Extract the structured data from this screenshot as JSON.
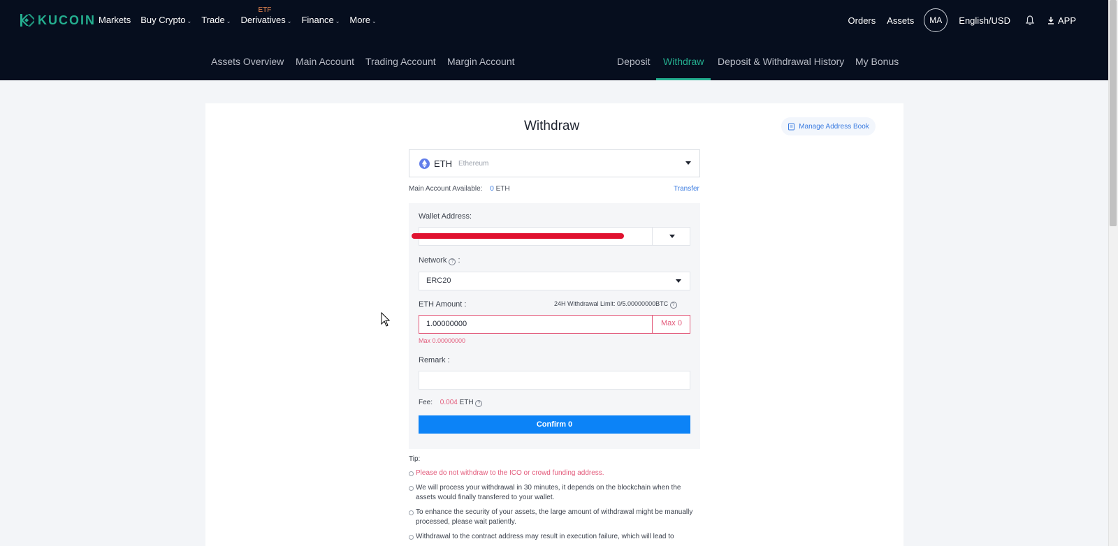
{
  "header": {
    "logo_text": "KUCOIN",
    "nav": [
      {
        "label": "Markets",
        "has_caret": false
      },
      {
        "label": "Buy Crypto",
        "has_caret": true
      },
      {
        "label": "Trade",
        "has_caret": true
      },
      {
        "label": "Derivatives",
        "has_caret": true,
        "badge": "ETF"
      },
      {
        "label": "Finance",
        "has_caret": true
      },
      {
        "label": "More",
        "has_caret": true
      }
    ],
    "right": {
      "orders": "Orders",
      "assets": "Assets",
      "avatar": "MA",
      "language": "English/USD",
      "app": "APP"
    }
  },
  "subnav": {
    "left": [
      "Assets Overview",
      "Main Account",
      "Trading Account",
      "Margin Account"
    ],
    "right": [
      "Deposit",
      "Withdraw",
      "Deposit & Withdrawal History",
      "My Bonus"
    ],
    "active": "Withdraw"
  },
  "withdraw": {
    "title": "Withdraw",
    "manage_address_book": "Manage Address Book",
    "coin": {
      "symbol": "ETH",
      "name": "Ethereum"
    },
    "available_label": "Main Account Available:",
    "available_value": "0",
    "available_unit": "ETH",
    "transfer": "Transfer",
    "wallet_address_label": "Wallet Address:",
    "network_label": "Network",
    "network_value": "ERC20",
    "amount_label": "ETH Amount :",
    "limit_text": "24H Withdrawal Limit: 0/5.00000000BTC",
    "amount_value": "1.00000000",
    "max_button": "Max 0",
    "amount_error": "Max 0.00000000",
    "remark_label": "Remark :",
    "fee_label": "Fee:",
    "fee_value": "0.004",
    "fee_unit": "ETH",
    "confirm_button": "Confirm 0",
    "tip_title": "Tip:",
    "tips": [
      "Please do not withdraw to the ICO or crowd funding address.",
      "We will process your withdrawal in 30 minutes, it depends on the blockchain when the assets would finally transfered to your wallet.",
      "To enhance the security of your assets, the large amount of withdrawal might be manually processed, please wait patiently.",
      "Withdrawal to the contract address may result in execution failure, which will lead to"
    ]
  },
  "colors": {
    "header_bg": "#060e1e",
    "brand_green": "#24ae8f",
    "primary_blue": "#0c83f7",
    "error_pink": "#e35b7b",
    "redaction_red": "#e0122f"
  }
}
